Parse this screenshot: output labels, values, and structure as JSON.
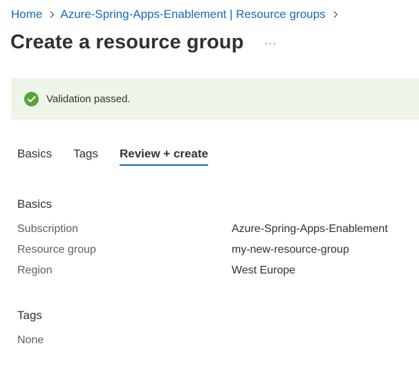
{
  "breadcrumb": {
    "items": [
      "Home",
      "Azure-Spring-Apps-Enablement | Resource groups"
    ]
  },
  "header": {
    "title": "Create a resource group",
    "more_label": "···"
  },
  "banner": {
    "status": "success",
    "icon": "check-circle-icon",
    "message": "Validation passed.",
    "background_color": "#eef5e8",
    "icon_color": "#55a33b"
  },
  "tabs": [
    {
      "label": "Basics",
      "active": false
    },
    {
      "label": "Tags",
      "active": false
    },
    {
      "label": "Review + create",
      "active": true
    }
  ],
  "accent_color": "#0f6cbd",
  "summary": {
    "basics": {
      "heading": "Basics",
      "rows": [
        {
          "label": "Subscription",
          "value": "Azure-Spring-Apps-Enablement"
        },
        {
          "label": "Resource group",
          "value": "my-new-resource-group"
        },
        {
          "label": "Region",
          "value": "West Europe"
        }
      ]
    },
    "tags": {
      "heading": "Tags",
      "value": "None"
    }
  }
}
